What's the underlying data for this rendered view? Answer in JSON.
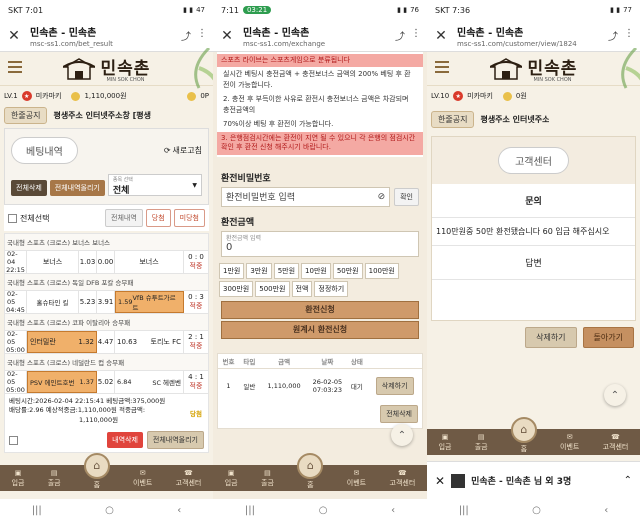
{
  "panel1": {
    "status": {
      "time": "SKT 7:01",
      "battery": "47"
    },
    "url": {
      "title": "민속촌 - 민속촌",
      "address": "msc-ss1.com/bet_result"
    },
    "logo": {
      "text": "민속촌",
      "sub": "MIN SOK CHON"
    },
    "user": {
      "level": "LV.1",
      "name": "미카마키",
      "money": "1,110,000원",
      "points": "0P"
    },
    "ticker": {
      "button": "한줄공지",
      "text": "평생주소 인터넷주소창 [평생"
    },
    "bet_history": {
      "title": "베팅내역",
      "refresh": "새로고침",
      "delete_all": "전체삭제",
      "upload_all": "전체내역올리기",
      "type_label": "종목 선택",
      "type_value": "전체",
      "select_all": "전체선택",
      "filters": [
        "전체내역",
        "당첨",
        "미당첨"
      ],
      "groups": [
        {
          "league": "국내형 스포츠 (크로스)  보너스  보너스",
          "rows": [
            {
              "date": "02-04",
              "time": "22:15",
              "home": "보너스",
              "odds_home": "1.03",
              "draw": "0.00",
              "away": "보너스",
              "score": "0 : 0",
              "result": "적중",
              "selected": ""
            }
          ]
        },
        {
          "league": "국내형 스포츠 (크로스)  독일 DFB 포칼  승무패",
          "rows": [
            {
              "date": "02-05",
              "time": "04:45",
              "home": "홀슈타인 킬",
              "odds_home": "5.23",
              "draw": "3.91",
              "away": "VfB 슈투트가르트",
              "odds_away": "1.59",
              "score": "0 : 3",
              "result": "적중",
              "selected": "away"
            }
          ]
        },
        {
          "league": "국내형 스포츠 (크로스)  코파 이탈리아  승무패",
          "rows": [
            {
              "date": "02-05",
              "time": "05:00",
              "home": "인터밀란",
              "odds_home": "1.32",
              "draw": "4.47",
              "away": "토리노 FC",
              "odds_away": "10.63",
              "score": "2 : 1",
              "result": "적중",
              "selected": "home"
            }
          ]
        },
        {
          "league": "국내형 스포츠 (크로스)  네덜란드 컵  승무패",
          "rows": [
            {
              "date": "02-05",
              "time": "05:00",
              "home": "PSV 에인트호번",
              "odds_home": "1.37",
              "draw": "5.02",
              "away": "SC 헤렌벤",
              "odds_away": "6.84",
              "score": "4 : 1",
              "result": "적중",
              "selected": "home"
            }
          ]
        }
      ],
      "summary": {
        "bet_time_label": "베팅시간",
        "bet_time": "2026-02-04 22:15:41",
        "bet_amount_label": "베팅금액",
        "bet_amount": "375,000원",
        "odds_label": "배당률",
        "odds": "2.96",
        "expected_label": "예상적중금",
        "expected": "1,110,000원",
        "win_label": "적중금액",
        "win": "1,110,000원",
        "status": "당첨"
      },
      "delete_btn": "내역삭제",
      "upload_btn": "전체내역올리기"
    },
    "nav": [
      "입금",
      "출금",
      "홈",
      "이벤트",
      "고객센터"
    ]
  },
  "panel2": {
    "status": {
      "time": "7:11",
      "call": "03:21",
      "battery": "76"
    },
    "url": {
      "title": "민속촌 - 민속촌",
      "address": "msc-ss1.com/exchange"
    },
    "notice_red_top": "스포츠 라이브는 스포츠게임으로 분류됩니다",
    "notices": [
      "실시간 베팅시 충전금액 + 충전보너스 금액의 200% 베팅 후 환전이 가능합니다.",
      "2. 충전 후 부득이한 사유로 환전시 충전보너스 금액은 차감되며 충전금액의",
      "70%이상 베팅 후 환전이 가능합니다."
    ],
    "notice_red_bottom": "3. 은행점검시간에는 환전이 지연 될 수 있으니 각 은행의 점검시간 확인 후 환전 신청 해주시기 바랍니다.",
    "password": {
      "title": "환전비밀번호",
      "placeholder": "환전비밀번호 입력",
      "confirm": "확인"
    },
    "amount": {
      "title": "환전금액",
      "label": "환전금액 입력",
      "value": "0"
    },
    "amount_buttons": [
      "1만원",
      "3만원",
      "5만원",
      "10만원",
      "50만원",
      "100만원",
      "300만원",
      "500만원",
      "전액",
      "정정하기"
    ],
    "apply_btn": "환전신청",
    "apply_simple_btn": "원계시 환전신청",
    "history": {
      "headers": [
        "번호",
        "타입",
        "금액",
        "날짜",
        "상태",
        ""
      ],
      "rows": [
        {
          "no": "1",
          "type": "일반",
          "amount": "1,110,000",
          "date": "26-02-05 07:03:23",
          "status": "대기",
          "action": "삭제하기"
        }
      ],
      "delete_all": "전체삭제"
    },
    "nav": [
      "입금",
      "출금",
      "홈",
      "이벤트",
      "고객센터"
    ]
  },
  "panel3": {
    "status": {
      "time": "SKT 7:36",
      "battery": "77"
    },
    "url": {
      "title": "민속촌 - 민속촌",
      "address": "msc-ss1.com/customer/view/1824"
    },
    "logo": {
      "text": "민속촌",
      "sub": "MIN SOK CHON"
    },
    "user": {
      "level": "LV.10",
      "name": "미카마키",
      "money": "0원"
    },
    "ticker": {
      "button": "한줄공지",
      "text": "평생주소 인터넷주소"
    },
    "cs_title": "고객센터",
    "inquiry_label": "문의",
    "inquiry_text": "110만원중 50만 환전됐습니다 60 입금 해주십시오",
    "answer_label": "답변",
    "delete_btn": "삭제하기",
    "back_btn": "돌아가기",
    "nav": [
      "입금",
      "출금",
      "홈",
      "이벤트",
      "고객센터"
    ],
    "notification": "민속촌 - 민속촌 님 외 3명"
  }
}
